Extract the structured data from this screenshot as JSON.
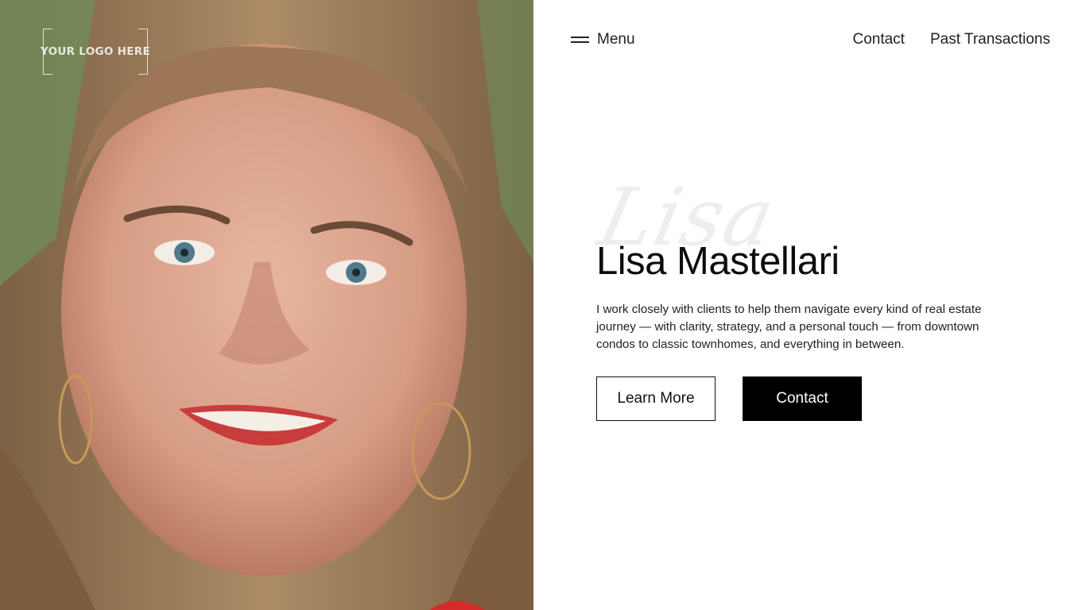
{
  "logo": {
    "text": "YOUR LOGO HERE"
  },
  "nav": {
    "menu_icon": "hamburger-icon",
    "menu_label": "Menu",
    "links": [
      {
        "label": "Contact"
      },
      {
        "label": "Past Transactions"
      }
    ]
  },
  "hero": {
    "script_name": "Lisa",
    "title": "Lisa Mastellari",
    "description": "I work closely with clients to help them navigate every kind of real estate journey — with clarity, strategy, and a personal touch — from downtown condos to classic townhomes, and everything in between.",
    "buttons": {
      "learn_more": "Learn More",
      "contact": "Contact"
    }
  },
  "colors": {
    "text": "#111111",
    "button_dark": "#000000",
    "background": "#ffffff"
  }
}
